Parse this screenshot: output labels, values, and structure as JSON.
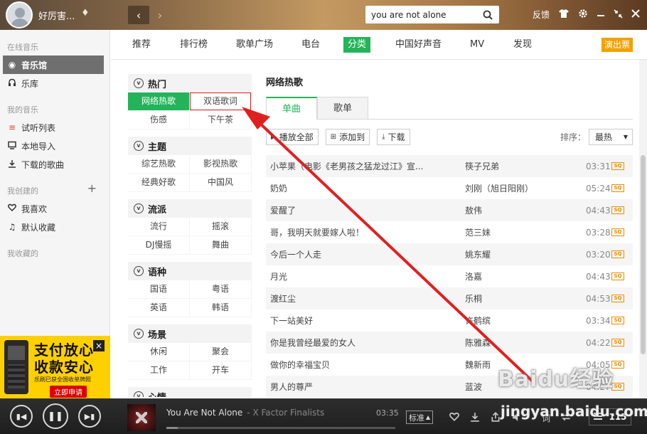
{
  "header": {
    "username": "好厉害...",
    "search_value": "you are not alone",
    "feedback_label": "反馈"
  },
  "sidebar": {
    "section_online": "在线音乐",
    "music_hall": "音乐馆",
    "library": "乐库",
    "section_mine": "我的音乐",
    "trial_list": "试听列表",
    "local_import": "本地导入",
    "downloaded": "下载的歌曲",
    "section_created": "我创建的",
    "favorites": "我喜欢",
    "default_collection": "默认收藏",
    "section_collected": "我收藏的"
  },
  "ad": {
    "line1": "支付放心",
    "line2": "收款安心",
    "line3": "乐刷已获全国收单牌照",
    "cta": "立即申请"
  },
  "tabs": [
    "推荐",
    "排行榜",
    "歌单广场",
    "电台",
    "分类",
    "中国好声音",
    "MV",
    "发现"
  ],
  "tabs_active_index": 4,
  "promo_label": "演出票",
  "categories": [
    {
      "title": "热门",
      "items": [
        "网络热歌",
        "双语歌词",
        "伤感",
        "下午茶"
      ]
    },
    {
      "title": "主题",
      "items": [
        "综艺热歌",
        "影视热歌",
        "经典好歌",
        "中国风"
      ]
    },
    {
      "title": "流派",
      "items": [
        "流行",
        "摇滚",
        "DJ慢摇",
        "舞曲"
      ]
    },
    {
      "title": "语种",
      "items": [
        "国语",
        "粤语",
        "英语",
        "韩语"
      ]
    },
    {
      "title": "场景",
      "items": [
        "休闲",
        "聚会",
        "工作",
        "开车"
      ]
    },
    {
      "title": "心情",
      "items": []
    }
  ],
  "main": {
    "title": "网络热歌",
    "subtab_single": "单曲",
    "subtab_playlist": "歌单",
    "play_all": "播放全部",
    "add_to": "添加到",
    "download": "下载",
    "sort_label": "排序：",
    "sort_value": "最热",
    "quality_badge": "SQ"
  },
  "songs": [
    {
      "name": "小苹果（电影《老男孩之猛龙过江》宣...",
      "artist": "筷子兄弟",
      "duration": "03:31"
    },
    {
      "name": "奶奶",
      "artist": "刘刚（旭日阳刚）",
      "duration": "05:24"
    },
    {
      "name": "爱醒了",
      "artist": "敖伟",
      "duration": "04:43"
    },
    {
      "name": "哥，我明天就要嫁人啦！",
      "artist": "范三妹",
      "duration": "03:28"
    },
    {
      "name": "今后一个人走",
      "artist": "姚东耀",
      "duration": "03:20"
    },
    {
      "name": "月光",
      "artist": "洛嘉",
      "duration": "04:43"
    },
    {
      "name": "渡红尘",
      "artist": "乐桐",
      "duration": "04:53"
    },
    {
      "name": "下一站美好",
      "artist": "许鹤缤",
      "duration": "03:34"
    },
    {
      "name": "你是我曾经最爱的女人",
      "artist": "陈雅森",
      "duration": "04:22"
    },
    {
      "name": "做你的幸福宝贝",
      "artist": "魏新雨",
      "duration": "04:05"
    },
    {
      "name": "男人的尊严",
      "artist": "蓝波",
      "duration": "04:27"
    }
  ],
  "player": {
    "track_title": "You Are Not Alone",
    "track_artist": "-  X Factor Finalists",
    "time": "03:35",
    "quality": "标准",
    "lyrics_label": "词",
    "playlist_count": "115",
    "progress": 0.05
  },
  "watermark": {
    "line1": "Baidu经验",
    "line2": "jingyan.baidu.com"
  },
  "colors": {
    "accent_green": "#23b45a",
    "annotation_red": "#e02020",
    "promo_orange": "#f3a100"
  }
}
